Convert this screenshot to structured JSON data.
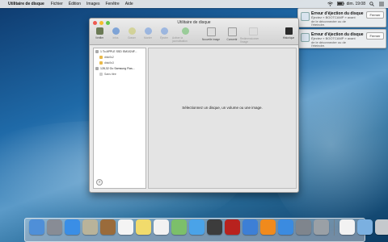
{
  "menubar": {
    "app_name": "Utilitaire de disque",
    "menus": [
      "Fichier",
      "Édition",
      "Images",
      "Fenêtre",
      "Aide"
    ],
    "clock": "dim. 19:08"
  },
  "notifications": [
    {
      "title": "Erreur d'éjection du disque",
      "body": "Éjectez « BOOTCAMP » avant de le déconnecter ou de l'éteindre.",
      "button": "Fermer"
    },
    {
      "title": "Erreur d'éjection du disque",
      "body": "Éjectez « BOOTCAMP » avant de le déconnecter ou de l'éteindre.",
      "button": "Fermer"
    }
  ],
  "window": {
    "title": "Utilitaire de disque",
    "toolbar": [
      {
        "label": "Vérifier",
        "icon": "microscope-icon",
        "color": "#6b7a55",
        "enabled": true
      },
      {
        "label": "Infos",
        "icon": "info-icon",
        "color": "#3d7bd1",
        "enabled": false
      },
      {
        "label": "Graver",
        "icon": "burn-icon",
        "color": "#c9c96a",
        "enabled": false
      },
      {
        "label": "Monter",
        "icon": "mount-icon",
        "color": "#6f9be0",
        "enabled": false
      },
      {
        "label": "Éjecter",
        "icon": "eject-icon",
        "color": "#6f9be0",
        "enabled": false
      },
      {
        "label": "Activer la journalisation",
        "icon": "journal-icon",
        "color": "#6cbf6a",
        "enabled": false
      },
      {
        "label": "Nouvelle image",
        "icon": "new-image-icon",
        "color": "#dddddd",
        "enabled": true
      },
      {
        "label": "Convertir",
        "icon": "convert-icon",
        "color": "#dddddd",
        "enabled": true
      },
      {
        "label": "Redimensionner l'image",
        "icon": "resize-icon",
        "color": "#dddddd",
        "enabled": false
      }
    ],
    "toolbar_right": {
      "label": "Historique",
      "icon": "log-icon"
    },
    "sidebar": [
      {
        "label": "1 To APPLE SSD SM1024F...",
        "type": "disk"
      },
      {
        "label": "disk0s2",
        "type": "volume"
      },
      {
        "label": "disk0s3",
        "type": "volume"
      },
      {
        "label": "128,32 Go Samsung Flas...",
        "type": "disk"
      },
      {
        "label": "Sans titre",
        "type": "volume"
      }
    ],
    "help_label": "?",
    "main_message": "Sélectionnez un disque, un volume ou une image."
  },
  "dock": [
    {
      "name": "finder-icon",
      "color": "#4f8fd8"
    },
    {
      "name": "launchpad-icon",
      "color": "#888c95"
    },
    {
      "name": "safari-icon",
      "color": "#3a8ee6"
    },
    {
      "name": "mail-icon",
      "color": "#b9b39a"
    },
    {
      "name": "contacts-icon",
      "color": "#9a6b3b"
    },
    {
      "name": "calendar-icon",
      "color": "#f4f4f4"
    },
    {
      "name": "notes-icon",
      "color": "#f1db6c"
    },
    {
      "name": "reminders-icon",
      "color": "#f2f2f2"
    },
    {
      "name": "maps-icon",
      "color": "#7cbf6a"
    },
    {
      "name": "messages-icon",
      "color": "#4aa3e8"
    },
    {
      "name": "facetime-icon",
      "color": "#3c3c3c"
    },
    {
      "name": "photo-booth-icon",
      "color": "#b8221e"
    },
    {
      "name": "itunes-icon",
      "color": "#3d7fd6"
    },
    {
      "name": "ibooks-icon",
      "color": "#f08a1c"
    },
    {
      "name": "app-store-icon",
      "color": "#3b8be0"
    },
    {
      "name": "system-preferences-icon",
      "color": "#7f858d"
    },
    {
      "name": "disk-utility-icon",
      "color": "#9aa0a6"
    },
    {
      "name": "document-icon",
      "color": "#f2f2f2"
    },
    {
      "name": "downloads-icon",
      "color": "#7bb0e0"
    },
    {
      "name": "trash-icon",
      "color": "#c5c9cd"
    }
  ]
}
